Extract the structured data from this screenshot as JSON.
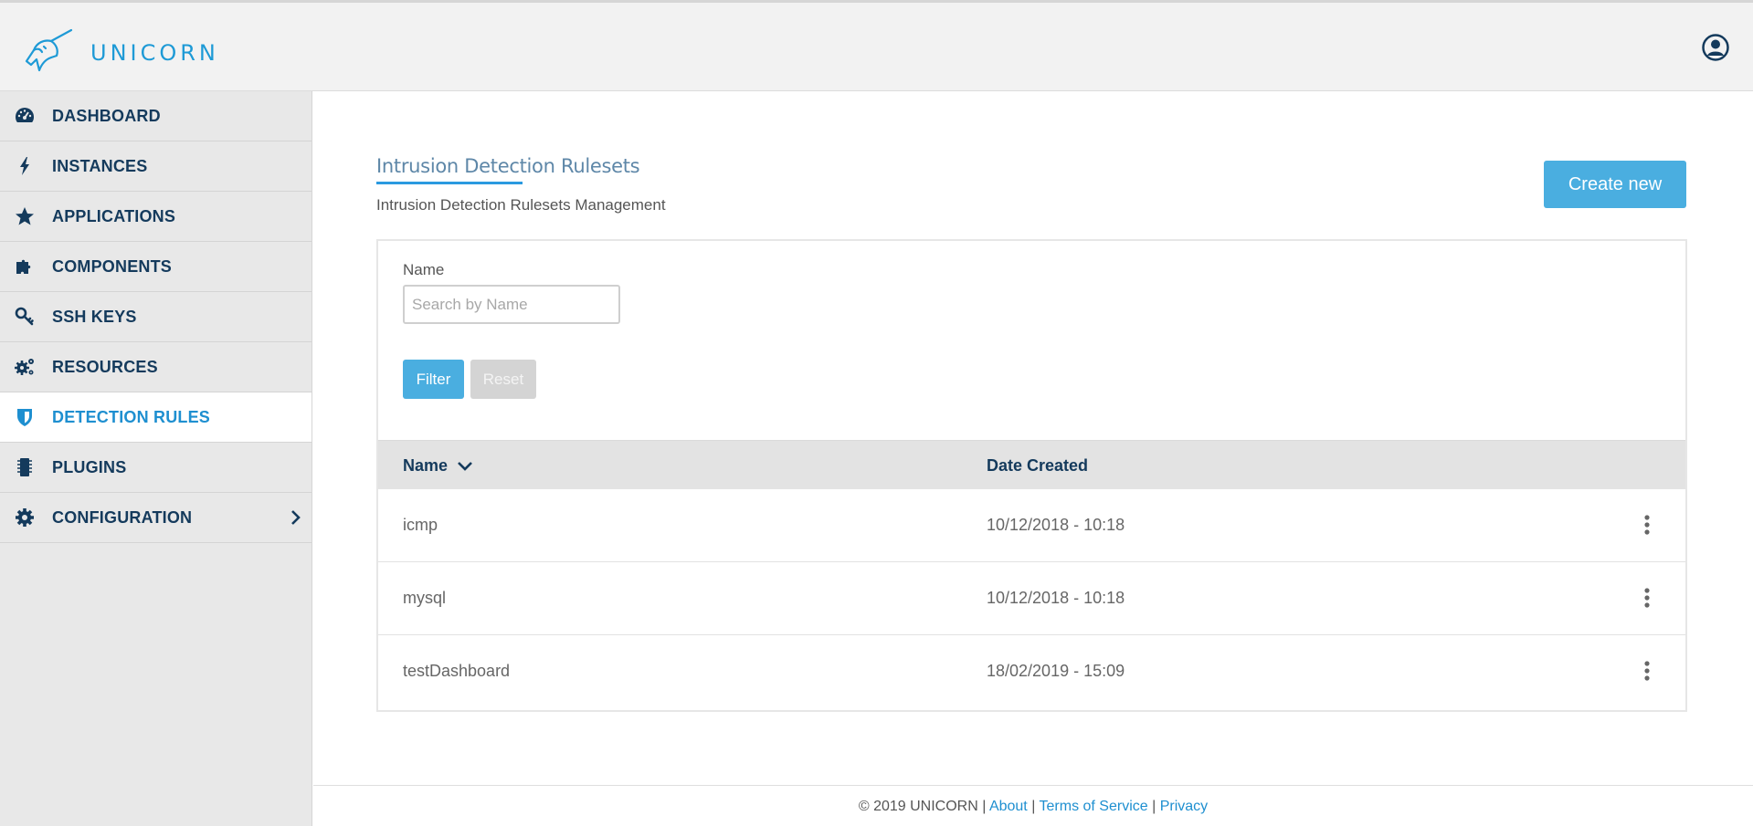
{
  "app": {
    "name": "UNICORN",
    "accent_color": "#1e9ad6",
    "header_bg": "#f2f2f2",
    "user_icon": "user-circle-icon"
  },
  "sidebar": {
    "items": [
      {
        "label": "DASHBOARD",
        "icon": "dashboard-gauge-icon",
        "active": false
      },
      {
        "label": "INSTANCES",
        "icon": "lightning-bolt-icon",
        "active": false
      },
      {
        "label": "APPLICATIONS",
        "icon": "star-icon",
        "active": false
      },
      {
        "label": "COMPONENTS",
        "icon": "puzzle-piece-icon",
        "active": false
      },
      {
        "label": "SSH KEYS",
        "icon": "key-icon",
        "active": false
      },
      {
        "label": "RESOURCES",
        "icon": "gears-icon",
        "active": false
      },
      {
        "label": "DETECTION RULES",
        "icon": "shield-icon",
        "active": true
      },
      {
        "label": "PLUGINS",
        "icon": "chip-icon",
        "active": false
      },
      {
        "label": "CONFIGURATION",
        "icon": "gear-icon",
        "active": false,
        "has_submenu": true
      }
    ]
  },
  "page": {
    "title": "Intrusion Detection Rulesets",
    "subtitle": "Intrusion Detection Rulesets Management",
    "create_label": "Create new"
  },
  "filter": {
    "name_label": "Name",
    "search_placeholder": "Search by Name",
    "search_value": "",
    "filter_label": "Filter",
    "reset_label": "Reset"
  },
  "table": {
    "columns": [
      "Name",
      "Date Created"
    ],
    "sort_column": "Name",
    "rows": [
      {
        "name": "icmp",
        "date": "10/12/2018 - 10:18"
      },
      {
        "name": "mysql",
        "date": "10/12/2018 - 10:18"
      },
      {
        "name": "testDashboard",
        "date": "18/02/2019 - 15:09"
      }
    ]
  },
  "footer": {
    "copyright": "© 2019 UNICORN",
    "separator": "|",
    "links": [
      "About",
      "Terms of Service",
      "Privacy"
    ]
  }
}
